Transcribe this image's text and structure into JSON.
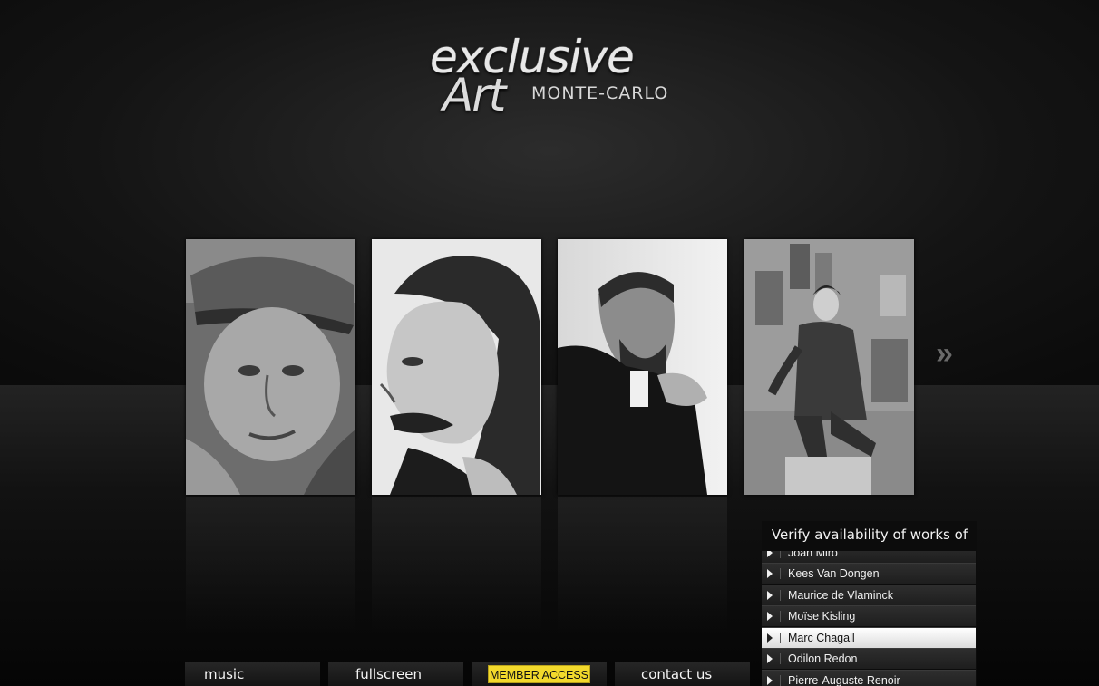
{
  "logo": {
    "word1": "exclusive",
    "word2": "Art",
    "word3": "MONTE-CARLO"
  },
  "gallery": {
    "next_icon": "double-chevron-right-icon",
    "portraits": [
      {
        "name": "portrait-1"
      },
      {
        "name": "portrait-2"
      },
      {
        "name": "portrait-3"
      },
      {
        "name": "portrait-4"
      }
    ]
  },
  "availability": {
    "title": "Verify availability of works of art",
    "items": [
      {
        "label": "Joan Miró",
        "active": false
      },
      {
        "label": "Kees Van Dongen",
        "active": false
      },
      {
        "label": "Maurice de Vlaminck",
        "active": false
      },
      {
        "label": "Moïse Kisling",
        "active": false
      },
      {
        "label": "Marc Chagall",
        "active": true
      },
      {
        "label": "Odilon Redon",
        "active": false
      },
      {
        "label": "Pierre-Auguste Renoir",
        "active": false
      }
    ]
  },
  "nav": {
    "music": "music",
    "fullscreen": "fullscreen",
    "member_access": "MEMBER ACCESS",
    "contact": "contact us"
  },
  "colors": {
    "accent": "#f2d92c",
    "background": "#141414"
  }
}
